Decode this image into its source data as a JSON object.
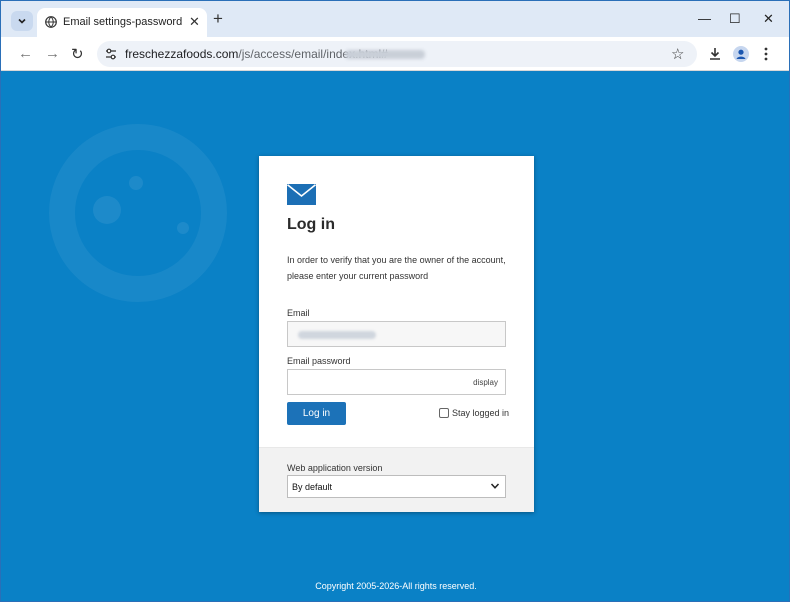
{
  "browser": {
    "tab_title": "Email settings-password mainte",
    "url_host": "freschezzafoods.com",
    "url_path": "/js/access/email/index.html#"
  },
  "login": {
    "title": "Log in",
    "description": "In order to verify that you are the owner of the account, please enter your current password",
    "email_label": "Email",
    "password_label": "Email password",
    "display_toggle": "display",
    "login_button": "Log in",
    "stay_logged_in": "Stay logged in",
    "version_label": "Web application version",
    "version_value": "By default"
  },
  "footer": {
    "copyright": "Copyright 2005-2026-All rights reserved."
  },
  "colors": {
    "page_bg": "#0a81c6",
    "button": "#1c72b8",
    "mail_icon": "#1c6fb5"
  }
}
